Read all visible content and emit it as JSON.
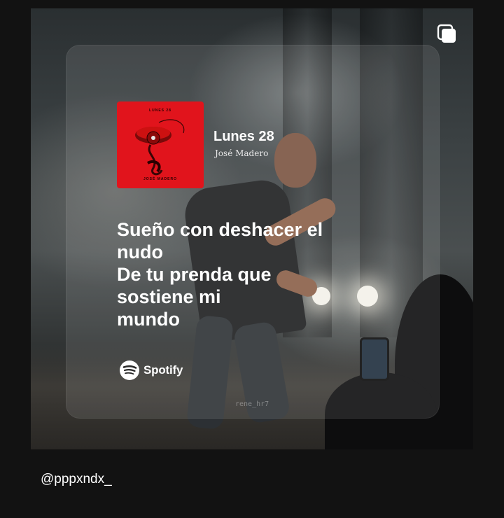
{
  "story": {
    "track_title": "Lunes 28",
    "artist": "José Madero",
    "album_cover_top_text": "LUNES 28",
    "album_cover_bottom_text": "JOSÉ MADERO",
    "lyrics": [
      "Sueño con deshacer el",
      "nudo",
      "De tu prenda que",
      "sostiene mi",
      "mundo"
    ],
    "spotify_label": "Spotify",
    "watermark": "rene_hr7"
  },
  "footer": {
    "username": "@pppxndx_"
  },
  "icons": {
    "top_right": "multiple-posts-icon",
    "brand": "spotify-icon",
    "album_art": "red-telephone-icon"
  },
  "colors": {
    "background": "#121212",
    "album_red": "#e1141c",
    "text": "#ffffff"
  }
}
